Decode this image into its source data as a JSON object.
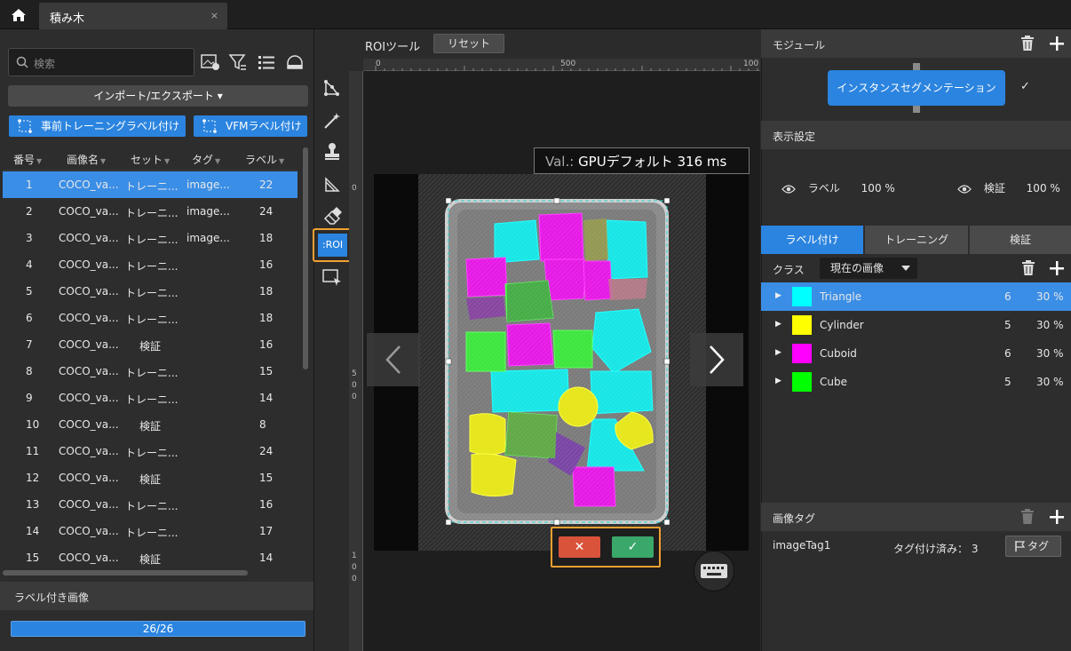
{
  "tab": {
    "title": "積み木",
    "close": "×"
  },
  "search": {
    "placeholder": "検索"
  },
  "left_actions": {
    "import_export": "インポート/エクスポート ▾",
    "pretrain_label": "事前トレーニングラベル付け",
    "vfm_label": "VFMラベル付け"
  },
  "table": {
    "headers": [
      "番号",
      "画像名",
      "セット",
      "タグ",
      "ラベル"
    ],
    "rows": [
      {
        "no": "1",
        "name": "COCO_va...",
        "set": "トレーニ...",
        "tag": "image...",
        "labels": "22"
      },
      {
        "no": "2",
        "name": "COCO_va...",
        "set": "トレーニ...",
        "tag": "image...",
        "labels": "24"
      },
      {
        "no": "3",
        "name": "COCO_va...",
        "set": "トレーニ...",
        "tag": "image...",
        "labels": "18"
      },
      {
        "no": "4",
        "name": "COCO_va...",
        "set": "トレーニ...",
        "tag": "",
        "labels": "16"
      },
      {
        "no": "5",
        "name": "COCO_va...",
        "set": "トレーニ...",
        "tag": "",
        "labels": "18"
      },
      {
        "no": "6",
        "name": "COCO_va...",
        "set": "トレーニ...",
        "tag": "",
        "labels": "18"
      },
      {
        "no": "7",
        "name": "COCO_va...",
        "set": "検証",
        "tag": "",
        "labels": "16"
      },
      {
        "no": "8",
        "name": "COCO_va...",
        "set": "トレーニ...",
        "tag": "",
        "labels": "15"
      },
      {
        "no": "9",
        "name": "COCO_va...",
        "set": "トレーニ...",
        "tag": "",
        "labels": "14"
      },
      {
        "no": "10",
        "name": "COCO_va...",
        "set": "検証",
        "tag": "",
        "labels": "8"
      },
      {
        "no": "11",
        "name": "COCO_va...",
        "set": "トレーニ...",
        "tag": "",
        "labels": "24"
      },
      {
        "no": "12",
        "name": "COCO_va...",
        "set": "検証",
        "tag": "",
        "labels": "15"
      },
      {
        "no": "13",
        "name": "COCO_va...",
        "set": "トレーニ...",
        "tag": "",
        "labels": "16"
      },
      {
        "no": "14",
        "name": "COCO_va...",
        "set": "トレーニ...",
        "tag": "",
        "labels": "17"
      },
      {
        "no": "15",
        "name": "COCO_va...",
        "set": "検証",
        "tag": "",
        "labels": "14"
      }
    ]
  },
  "labeled_images": {
    "title": "ラベル付き画像",
    "progress_text": "26/26",
    "progress": 1.0
  },
  "toolbar": {
    "roi_label": ":ROI"
  },
  "center": {
    "roi_tool_title": "ROIツール",
    "reset": "リセット",
    "ruler_h": [
      "0",
      "500",
      "100"
    ],
    "ruler_v": [
      "0",
      "500",
      "100"
    ],
    "val_key": "Val.:",
    "val_text": "GPUデフォルト 316 ms",
    "cancel": "✕",
    "ok": "✓"
  },
  "right": {
    "module_title": "モジュール",
    "module_name": "インスタンスセグメンテーション",
    "module_check": "✓",
    "display_title": "表示設定",
    "label_vis": "ラベル",
    "label_pct": "100 %",
    "valid_vis": "検証",
    "valid_pct": "100 %",
    "tabs": [
      "ラベル付け",
      "トレーニング",
      "検証"
    ],
    "class_label": "クラス",
    "class_filter": "現在の画像",
    "classes": [
      {
        "name": "Triangle",
        "count": "6",
        "pct": "30 %",
        "color": "#00ffff"
      },
      {
        "name": "Cylinder",
        "count": "5",
        "pct": "30 %",
        "color": "#ffff00"
      },
      {
        "name": "Cuboid",
        "count": "6",
        "pct": "30 %",
        "color": "#ff00ff"
      },
      {
        "name": "Cube",
        "count": "5",
        "pct": "30 %",
        "color": "#00ff00"
      }
    ],
    "image_tag_title": "画像タグ",
    "image_tag_name": "imageTag1",
    "tagged_count": "タグ付け済み： 3",
    "tag_button": "タグ"
  }
}
